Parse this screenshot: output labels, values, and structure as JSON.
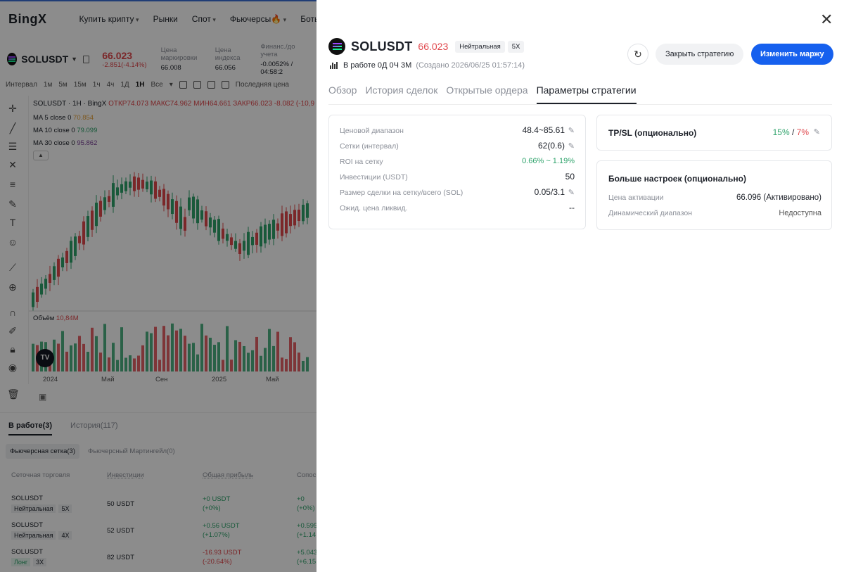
{
  "bg": {
    "logo": "BingX",
    "nav": [
      "Купить крипту",
      "Рынки",
      "Спот",
      "Фьючерсы🔥",
      "Боты"
    ],
    "symbol": "SOLUSDT",
    "last_price": "66.023",
    "last_change": "-2.851(-4.14%)",
    "stats": [
      {
        "label": "Цена маркировки",
        "value": "66.008"
      },
      {
        "label": "Цена индекса",
        "value": "66.056"
      },
      {
        "label": "Финанс./до учета",
        "value": "-0.0052% / 04:58:2"
      }
    ],
    "intervals": [
      "Интервал",
      "1м",
      "5м",
      "15м",
      "1ч",
      "4ч",
      "1Д",
      "1Н",
      "Все"
    ],
    "active_interval": "1Н",
    "last_price_label": "Последняя цена",
    "chart_title": "SOLUSDT · 1Н · BingX",
    "ohlc": "ОТКР74.073 МАКС74.962 МИН64.661 ЗАКР66.023 -8.082 (-10,9",
    "ma5": {
      "label": "MA 5 close 0",
      "value": "70.854"
    },
    "ma10": {
      "label": "MA 10 close 0",
      "value": "79.099"
    },
    "ma30": {
      "label": "MA 30 close 0",
      "value": "95.862"
    },
    "volume_label": "Объём",
    "volume_value": "10,84M",
    "x_ticks": [
      "2024",
      "Май",
      "Сен",
      "2025",
      "Май"
    ],
    "orders_tabs": [
      "В работе(3)",
      "История(117)"
    ],
    "sub_tabs": [
      "Фьючерсная сетка(3)",
      "Фьючерсный Мартингейл(0)"
    ],
    "grid_headers": [
      "Сеточная торговля",
      "Инвестиции",
      "Общая прибыль",
      "Сопос"
    ],
    "rows": [
      {
        "symbol": "SOLUSDT",
        "dir": "Нейтральная",
        "lev": "5X",
        "inv": "50 USDT",
        "pnl": "+0 USDT",
        "pnl_pct": "(+0%)",
        "p2": "+0",
        "p2_pct": "(+0%)"
      },
      {
        "symbol": "SOLUSDT",
        "dir": "Нейтральная",
        "lev": "4X",
        "inv": "52 USDT",
        "pnl": "+0.56 USDT",
        "pnl_pct": "(+1.07%)",
        "p2": "+0.595",
        "p2_pct": "(+1.14"
      },
      {
        "symbol": "SOLUSDT",
        "dir": "Лонг",
        "lev": "3X",
        "inv": "82 USDT",
        "pnl": "-16.93 USDT",
        "pnl_pct": "(-20.64%)",
        "p2": "+5.043",
        "p2_pct": "(+6.15"
      }
    ]
  },
  "drawer": {
    "symbol": "SOLUSDT",
    "price": "66.023",
    "mode": "Нейтральная",
    "leverage": "5X",
    "running": "В работе 0Д 0Ч 3М",
    "created": "(Создано 2026/06/25 01:57:14)",
    "close_btn": "Закрыть стратегию",
    "margin_btn": "Изменить маржу",
    "tabs": [
      "Обзор",
      "История сделок",
      "Открытые ордера",
      "Параметры стратегии"
    ],
    "params": [
      {
        "key": "Ценовой диапазон",
        "value": "48.4~85.61"
      },
      {
        "key": "Сетки (интервал)",
        "value": "62(0.6)"
      },
      {
        "key": "ROI на сетку",
        "value": "0.66% ~ 1.19%"
      },
      {
        "key": "Инвестиции (USDT)",
        "value": "50"
      },
      {
        "key": "Размер сделки на сетку/всего (SOL)",
        "value": "0.05/3.1"
      },
      {
        "key": "Ожид. цена ликвид.",
        "value": "--"
      }
    ],
    "tpsl_title": "TP/SL (опционально)",
    "tp": "15%",
    "tpsl_sep": " / ",
    "sl": "7%",
    "more_title": "Больше настроек (опционально)",
    "activation_label": "Цена активации",
    "activation_value": "66.096  (Активировано)",
    "dynamic_label": "Динамический диапазон",
    "dynamic_value": "Недоступна"
  },
  "colors": {
    "accent": "#1660ee",
    "up": "#2ea36b",
    "down": "#e0474c"
  },
  "icons": [
    "close-icon",
    "refresh-icon",
    "edit-icon",
    "chart-bars-icon",
    "solana-icon",
    "tradingview-icon"
  ]
}
